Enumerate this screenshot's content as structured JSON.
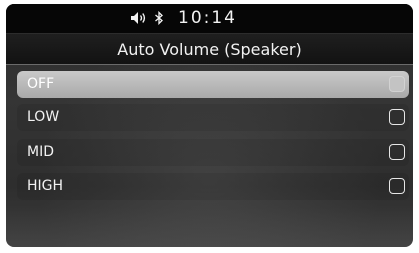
{
  "status_bar": {
    "time": "10:14",
    "icons": [
      "speaker-volume-icon",
      "bluetooth-icon"
    ]
  },
  "header": {
    "title": "Auto Volume (Speaker)"
  },
  "options": [
    {
      "label": "OFF",
      "selected": true,
      "checked": false
    },
    {
      "label": "LOW",
      "selected": false,
      "checked": false
    },
    {
      "label": "MID",
      "selected": false,
      "checked": false
    },
    {
      "label": "HIGH",
      "selected": false,
      "checked": false
    }
  ],
  "colors": {
    "background": "#2e2e2e",
    "status_bar": "#060606",
    "header": "#181818",
    "highlight": "#bdbdbd",
    "text": "#f2f2f2"
  }
}
